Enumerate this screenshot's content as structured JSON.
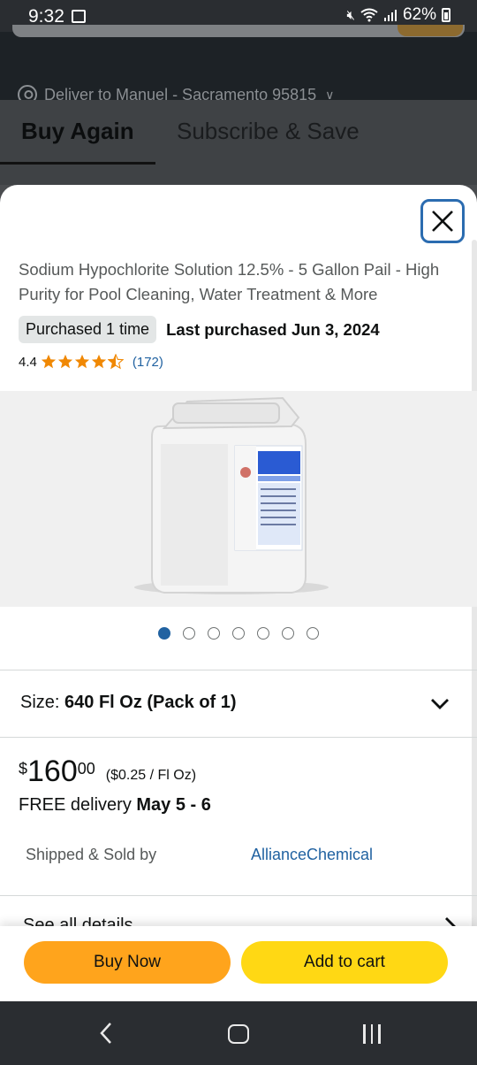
{
  "status_bar": {
    "time": "9:32",
    "battery": "62%"
  },
  "header": {
    "deliver_to": "Deliver to Manuel - Sacramento 95815"
  },
  "tabs": [
    {
      "label": "Buy Again",
      "active": true
    },
    {
      "label": "Subscribe & Save",
      "active": false
    }
  ],
  "product": {
    "title": "Sodium Hypochlorite Solution 12.5% - 5 Gallon Pail - High Purity for Pool Cleaning, Water Treatment & More",
    "purchased_badge": "Purchased 1 time",
    "last_purchased": "Last purchased Jun 3, 2024",
    "rating": "4.4",
    "rating_stars": 4.5,
    "review_count": "(172)",
    "image_dots_total": 7,
    "image_dots_active": 1,
    "size_label": "Size:",
    "size_value": "640 Fl Oz (Pack of 1)",
    "price_currency": "$",
    "price_whole": "160",
    "price_fraction": "00",
    "unit_price": "($0.25 / Fl Oz)",
    "delivery_prefix": "FREE delivery",
    "delivery_date": "May 5 - 6",
    "shipped_label": "Shipped & Sold by",
    "seller": "AllianceChemical",
    "see_details": "See all details"
  },
  "actions": {
    "buy_now": "Buy Now",
    "add_to_cart": "Add to cart"
  },
  "colors": {
    "buy_now": "#ffa41c",
    "add_to_cart": "#ffd814",
    "link": "#2162a1",
    "star": "#f08804",
    "close_border": "#2b6cb0"
  },
  "icons": [
    "gallery-icon",
    "mute-icon",
    "wifi-icon",
    "signal-icon",
    "battery-icon",
    "location-pin-icon",
    "close-icon",
    "star-icon",
    "chevron-down-icon",
    "chevron-right-icon",
    "back-icon",
    "home-icon",
    "recent-apps-icon"
  ]
}
